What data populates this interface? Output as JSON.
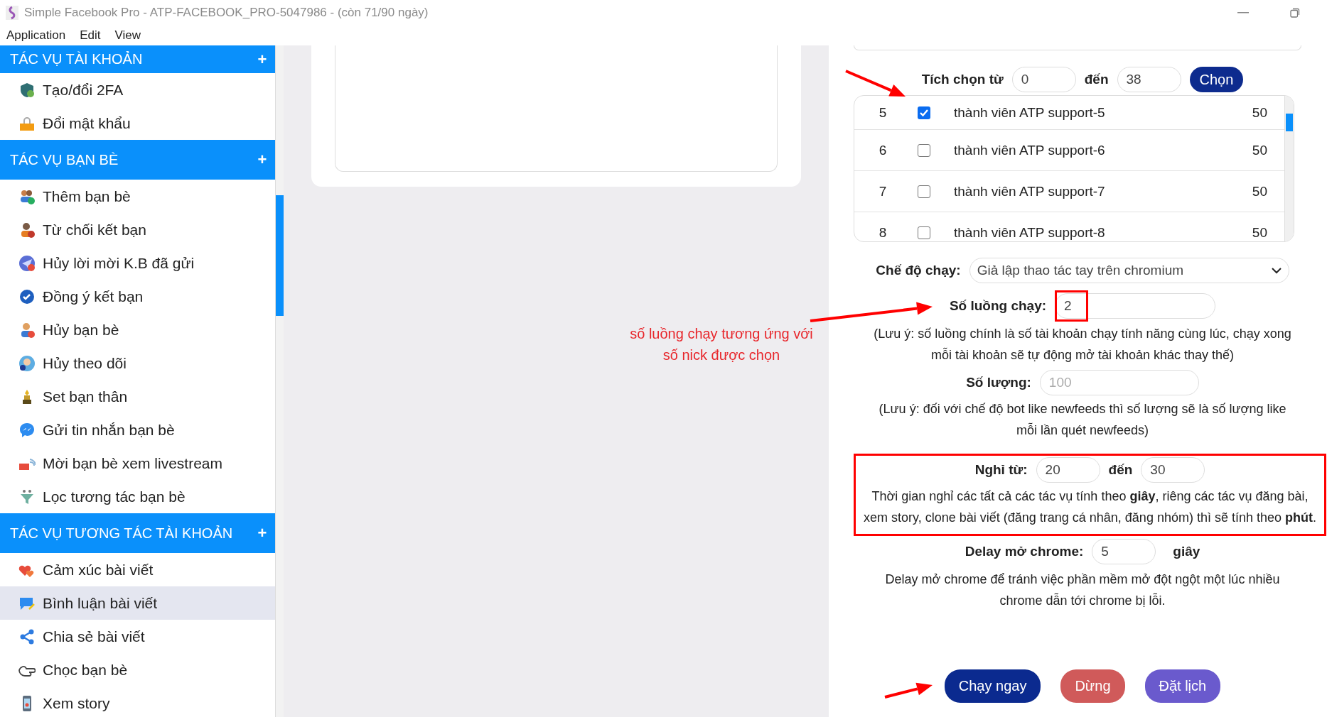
{
  "window": {
    "title": "Simple Facebook Pro - ATP-FACEBOOK_PRO-5047986 - (còn 71/90 ngày)"
  },
  "menu": [
    "Application",
    "Edit",
    "View"
  ],
  "sidebar": {
    "sections": [
      {
        "title": "TÁC VỤ TÀI KHOẢN",
        "toggle": "+",
        "items": [
          {
            "label": "Tạo/đổi 2FA",
            "selected": false
          },
          {
            "label": "Đổi mật khẩu",
            "selected": false
          }
        ]
      },
      {
        "title": "TÁC VỤ BẠN BÈ",
        "toggle": "+",
        "items": [
          {
            "label": "Thêm bạn bè",
            "selected": false
          },
          {
            "label": "Từ chối kết bạn",
            "selected": false
          },
          {
            "label": "Hủy lời mời K.B đã gửi",
            "selected": false
          },
          {
            "label": "Đồng ý kết bạn",
            "selected": false
          },
          {
            "label": "Hủy bạn bè",
            "selected": false
          },
          {
            "label": "Hủy theo dõi",
            "selected": false
          },
          {
            "label": "Set bạn thân",
            "selected": false
          },
          {
            "label": "Gửi tin nhắn bạn bè",
            "selected": false
          },
          {
            "label": "Mời bạn bè xem livestream",
            "selected": false
          },
          {
            "label": "Lọc tương tác bạn bè",
            "selected": false
          }
        ]
      },
      {
        "title": "TÁC VỤ TƯƠNG TÁC TÀI KHOẢN",
        "toggle": "+",
        "items": [
          {
            "label": "Cảm xúc bài viết",
            "selected": false
          },
          {
            "label": "Bình luận bài viết",
            "selected": true
          },
          {
            "label": "Chia sẻ bài viết",
            "selected": false
          },
          {
            "label": "Chọc bạn bè",
            "selected": false
          },
          {
            "label": "Xem story",
            "selected": false
          }
        ]
      }
    ]
  },
  "range_select": {
    "label": "Tích chọn từ",
    "from": "0",
    "to_label": "đến",
    "to": "38",
    "button": "Chọn"
  },
  "accounts": [
    {
      "index": "5",
      "checked": true,
      "name": "thành viên ATP support-5",
      "count": "50"
    },
    {
      "index": "6",
      "checked": false,
      "name": "thành viên ATP support-6",
      "count": "50"
    },
    {
      "index": "7",
      "checked": false,
      "name": "thành viên ATP support-7",
      "count": "50"
    },
    {
      "index": "8",
      "checked": false,
      "name": "thành viên ATP support-8",
      "count": "50"
    }
  ],
  "run_mode": {
    "label": "Chế độ chạy:",
    "value": "Giả lập thao tác tay trên chromium"
  },
  "threads": {
    "label": "Số luồng chạy:",
    "value": "2",
    "note": "(Lưu ý: số luồng chính là số tài khoản chạy tính năng cùng lúc, chạy xong mỗi tài khoản sẽ tự động mở tài khoản khác thay thế)"
  },
  "quantity": {
    "label": "Số lượng:",
    "placeholder": "100",
    "note": "(Lưu ý: đối với chế độ bot like newfeeds thì số lượng sẽ là số lượng like mỗi lần quét newfeeds)"
  },
  "rest": {
    "label": "Nghỉ từ:",
    "from": "20",
    "to_label": "đến",
    "to": "30",
    "note": "Thời gian nghỉ các tất cả các tác vụ tính theo **giây**, riêng các tác vụ đăng bài, xem story, clone bài viết (đăng trang cá nhân, đăng nhóm) thì sẽ tính theo **phút**."
  },
  "chrome_delay": {
    "label": "Delay mở chrome:",
    "value": "5",
    "unit": "giây",
    "note": "Delay mở chrome để tránh việc phần mềm mở đột ngột một lúc nhiều chrome dẫn tới chrome bị lỗi."
  },
  "buttons": [
    {
      "label": "Chạy ngay",
      "kind": "primary"
    },
    {
      "label": "Dừng",
      "kind": "danger"
    },
    {
      "label": "Đặt lịch",
      "kind": "schedule"
    }
  ],
  "annotation": {
    "text": "số luồng chạy tương ứng với số nick được chọn"
  }
}
